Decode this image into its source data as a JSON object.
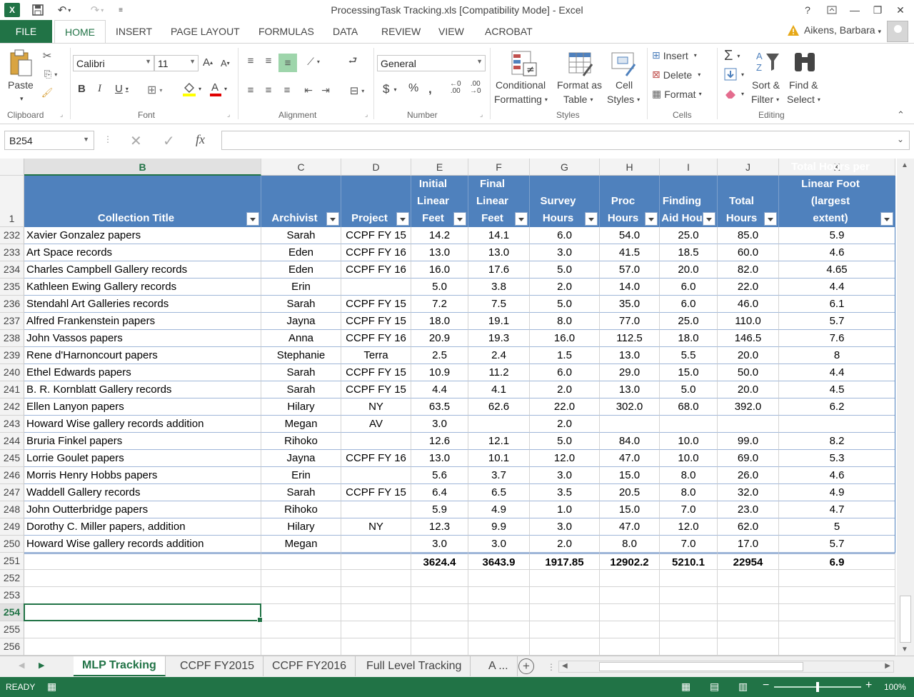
{
  "window": {
    "title": "ProcessingTask Tracking.xls  [Compatibility Mode] - Excel",
    "help": "?",
    "user": "Aikens, Barbara"
  },
  "ribbon_tabs": [
    "FILE",
    "HOME",
    "INSERT",
    "PAGE LAYOUT",
    "FORMULAS",
    "DATA",
    "REVIEW",
    "VIEW",
    "ACROBAT"
  ],
  "ribbon": {
    "paste": "Paste",
    "font_name": "Calibri",
    "font_size": "11",
    "number_format": "General",
    "conditional": [
      "Conditional",
      "Formatting"
    ],
    "format_table": [
      "Format as",
      "Table"
    ],
    "cell_styles": [
      "Cell",
      "Styles"
    ],
    "insert": "Insert",
    "delete": "Delete",
    "format": "Format",
    "sort_filter": [
      "Sort &",
      "Filter"
    ],
    "find_select": [
      "Find &",
      "Select"
    ],
    "groups": [
      "Clipboard",
      "Font",
      "Alignment",
      "Number",
      "Styles",
      "Cells",
      "Editing"
    ]
  },
  "formula_bar": {
    "name_box": "B254",
    "fx": "fx",
    "value": ""
  },
  "columns": [
    "B",
    "C",
    "D",
    "E",
    "F",
    "G",
    "H",
    "I",
    "J",
    "K"
  ],
  "header_row": {
    "row_number": "1",
    "cells": [
      [
        "Collection Title"
      ],
      [
        "Archivist"
      ],
      [
        "Project"
      ],
      [
        "Initial",
        "Linear",
        "Feet"
      ],
      [
        "Final",
        "Linear",
        "Feet"
      ],
      [
        "Survey",
        "Hours"
      ],
      [
        "Proc",
        "Hours"
      ],
      [
        "Finding",
        "Aid Hou"
      ],
      [
        "Total",
        "Hours"
      ],
      [
        "Total Hours per",
        "Linear Foot (largest",
        "extent)"
      ]
    ]
  },
  "rows": [
    {
      "n": "232",
      "cells": [
        "Xavier Gonzalez papers",
        "Sarah",
        "CCPF FY 15",
        "14.2",
        "14.1",
        "6.0",
        "54.0",
        "25.0",
        "85.0",
        "5.9"
      ]
    },
    {
      "n": "233",
      "cells": [
        "Art Space records",
        "Eden",
        "CCPF FY 16",
        "13.0",
        "13.0",
        "3.0",
        "41.5",
        "18.5",
        "60.0",
        "4.6"
      ]
    },
    {
      "n": "234",
      "cells": [
        "Charles Campbell Gallery records",
        "Eden",
        "CCPF FY 16",
        "16.0",
        "17.6",
        "5.0",
        "57.0",
        "20.0",
        "82.0",
        "4.65"
      ]
    },
    {
      "n": "235",
      "cells": [
        "Kathleen Ewing Gallery records",
        "Erin",
        "",
        "5.0",
        "3.8",
        "2.0",
        "14.0",
        "6.0",
        "22.0",
        "4.4"
      ]
    },
    {
      "n": "236",
      "cells": [
        "Stendahl Art Galleries records",
        "Sarah",
        "CCPF FY 15",
        "7.2",
        "7.5",
        "5.0",
        "35.0",
        "6.0",
        "46.0",
        "6.1"
      ]
    },
    {
      "n": "237",
      "cells": [
        "Alfred Frankenstein papers",
        "Jayna",
        "CCPF FY 15",
        "18.0",
        "19.1",
        "8.0",
        "77.0",
        "25.0",
        "110.0",
        "5.7"
      ]
    },
    {
      "n": "238",
      "cells": [
        "John Vassos papers",
        "Anna",
        "CCPF FY 16",
        "20.9",
        "19.3",
        "16.0",
        "112.5",
        "18.0",
        "146.5",
        "7.6"
      ]
    },
    {
      "n": "239",
      "cells": [
        "Rene d'Harnoncourt papers",
        "Stephanie",
        "Terra",
        "2.5",
        "2.4",
        "1.5",
        "13.0",
        "5.5",
        "20.0",
        "8"
      ]
    },
    {
      "n": "240",
      "cells": [
        "Ethel Edwards papers",
        "Sarah",
        "CCPF FY 15",
        "10.9",
        "11.2",
        "6.0",
        "29.0",
        "15.0",
        "50.0",
        "4.4"
      ]
    },
    {
      "n": "241",
      "cells": [
        "B. R. Kornblatt Gallery records",
        "Sarah",
        "CCPF FY 15",
        "4.4",
        "4.1",
        "2.0",
        "13.0",
        "5.0",
        "20.0",
        "4.5"
      ]
    },
    {
      "n": "242",
      "cells": [
        "Ellen Lanyon papers",
        "Hilary",
        "NY",
        "63.5",
        "62.6",
        "22.0",
        "302.0",
        "68.0",
        "392.0",
        "6.2"
      ]
    },
    {
      "n": "243",
      "cells": [
        "Howard Wise gallery records addition",
        "Megan",
        "AV",
        "3.0",
        "",
        "2.0",
        "",
        "",
        "",
        ""
      ]
    },
    {
      "n": "244",
      "cells": [
        "Bruria Finkel papers",
        "Rihoko",
        "",
        "12.6",
        "12.1",
        "5.0",
        "84.0",
        "10.0",
        "99.0",
        "8.2"
      ]
    },
    {
      "n": "245",
      "cells": [
        "Lorrie Goulet papers",
        "Jayna",
        "CCPF FY 16",
        "13.0",
        "10.1",
        "12.0",
        "47.0",
        "10.0",
        "69.0",
        "5.3"
      ]
    },
    {
      "n": "246",
      "cells": [
        "Morris Henry Hobbs papers",
        "Erin",
        "",
        "5.6",
        "3.7",
        "3.0",
        "15.0",
        "8.0",
        "26.0",
        "4.6"
      ]
    },
    {
      "n": "247",
      "cells": [
        "Waddell Gallery records",
        "Sarah",
        "CCPF FY 15",
        "6.4",
        "6.5",
        "3.5",
        "20.5",
        "8.0",
        "32.0",
        "4.9"
      ]
    },
    {
      "n": "248",
      "cells": [
        "John Outterbridge papers",
        "Rihoko",
        "",
        "5.9",
        "4.9",
        "1.0",
        "15.0",
        "7.0",
        "23.0",
        "4.7"
      ]
    },
    {
      "n": "249",
      "cells": [
        "Dorothy C. Miller papers, addition",
        "Hilary",
        "NY",
        "12.3",
        "9.9",
        "3.0",
        "47.0",
        "12.0",
        "62.0",
        "5"
      ]
    },
    {
      "n": "250",
      "cells": [
        "Howard Wise gallery records addition",
        "Megan",
        "",
        "3.0",
        "3.0",
        "2.0",
        "8.0",
        "7.0",
        "17.0",
        "5.7"
      ]
    },
    {
      "n": "251",
      "cells": [
        "",
        "",
        "",
        "3624.4",
        "3643.9",
        "1917.85",
        "12902.2",
        "5210.1",
        "22954",
        "6.9"
      ],
      "total": true
    },
    {
      "n": "252",
      "cells": [
        "",
        "",
        "",
        "",
        "",
        "",
        "",
        "",
        "",
        ""
      ]
    },
    {
      "n": "253",
      "cells": [
        "",
        "",
        "",
        "",
        "",
        "",
        "",
        "",
        "",
        ""
      ]
    },
    {
      "n": "254",
      "cells": [
        "",
        "",
        "",
        "",
        "",
        "",
        "",
        "",
        "",
        ""
      ]
    },
    {
      "n": "255",
      "cells": [
        "",
        "",
        "",
        "",
        "",
        "",
        "",
        "",
        "",
        ""
      ]
    },
    {
      "n": "256",
      "cells": [
        "",
        "",
        "",
        "",
        "",
        "",
        "",
        "",
        "",
        ""
      ]
    }
  ],
  "sheet_tabs": [
    "MLP Tracking",
    "CCPF FY2015",
    "CCPF FY2016",
    "Full Level Tracking",
    "A ..."
  ],
  "status": {
    "mode": "READY",
    "zoom": "100%"
  },
  "colors": {
    "accent": "#217346",
    "table_header": "#4f81bd"
  }
}
